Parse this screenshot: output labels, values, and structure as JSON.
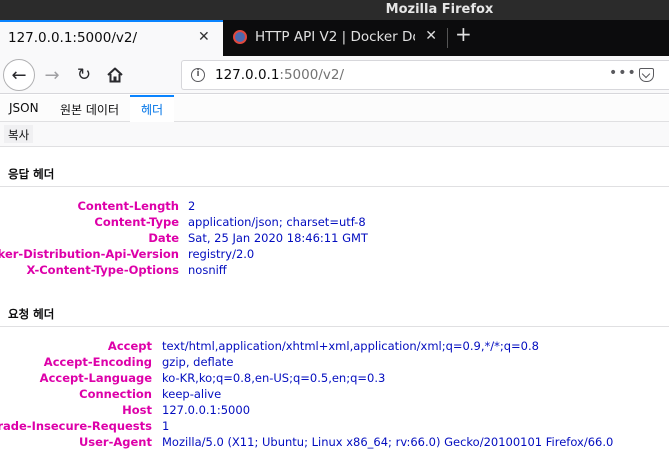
{
  "window": {
    "title": "Mozilla Firefox"
  },
  "tabs": [
    {
      "label": "127.0.0.1:5000/v2/",
      "active": true
    },
    {
      "label": "HTTP API V2 | Docker Do",
      "active": false
    }
  ],
  "nav": {
    "url_host": "127.0.0.1",
    "url_rest": ":5000/v2/",
    "page_actions": "•••"
  },
  "viewer": {
    "tabs": [
      "JSON",
      "원본 데이터",
      "헤더"
    ],
    "active_tab": "헤더",
    "copy_label": "복사"
  },
  "response_headers": {
    "title": "응답 헤더",
    "rows": [
      {
        "name": "Content-Length",
        "value": "2"
      },
      {
        "name": "Content-Type",
        "value": "application/json; charset=utf-8"
      },
      {
        "name": "Date",
        "value": "Sat, 25 Jan 2020 18:46:11 GMT"
      },
      {
        "name": "Docker-Distribution-Api-Version",
        "value": "registry/2.0"
      },
      {
        "name": "X-Content-Type-Options",
        "value": "nosniff"
      }
    ]
  },
  "request_headers": {
    "title": "요청 헤더",
    "rows": [
      {
        "name": "Accept",
        "value": "text/html,application/xhtml+xml,application/xml;q=0.9,*/*;q=0.8"
      },
      {
        "name": "Accept-Encoding",
        "value": "gzip, deflate"
      },
      {
        "name": "Accept-Language",
        "value": "ko-KR,ko;q=0.8,en-US;q=0.5,en;q=0.3"
      },
      {
        "name": "Connection",
        "value": "keep-alive"
      },
      {
        "name": "Host",
        "value": "127.0.0.1:5000"
      },
      {
        "name": "Upgrade-Insecure-Requests",
        "value": "1"
      },
      {
        "name": "User-Agent",
        "value": "Mozilla/5.0 (X11; Ubuntu; Linux x86_64; rv:66.0) Gecko/20100101 Firefox/66.0"
      }
    ]
  },
  "colors": {
    "header_name": "#dd00a9",
    "header_value": "#030dbf",
    "accent": "#0a84ff"
  }
}
